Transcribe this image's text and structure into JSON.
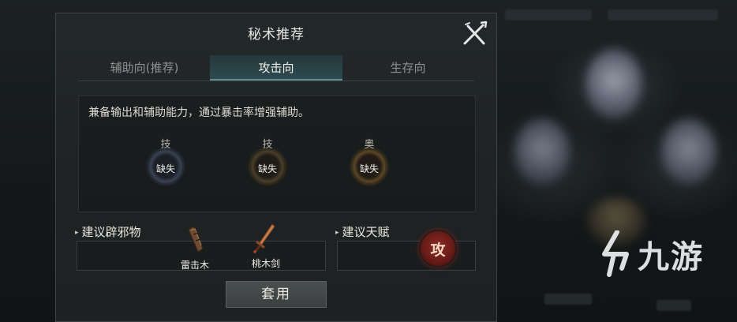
{
  "dialog": {
    "title": "秘术推荐",
    "tabs": [
      {
        "label": "辅助向(推荐)",
        "active": false
      },
      {
        "label": "攻击向",
        "active": true
      },
      {
        "label": "生存向",
        "active": false
      }
    ],
    "description": "兼备输出和辅助能力，通过暴击率增强辅助。",
    "slots": [
      {
        "tag": "技",
        "status": "缺失"
      },
      {
        "tag": "技",
        "status": "缺失"
      },
      {
        "tag": "奥",
        "status": "缺失"
      }
    ],
    "exorcism": {
      "heading": "建议辟邪物",
      "items": [
        {
          "name": "雷击木",
          "icon": "thunderwood-icon"
        },
        {
          "name": "桃木剑",
          "icon": "peachwood-sword-icon"
        }
      ]
    },
    "talent": {
      "heading": "建议天赋",
      "badge": "攻"
    },
    "apply_label": "套用"
  },
  "watermark": {
    "text": "九游"
  },
  "colors": {
    "active_tab": "#2e4a4f",
    "talent_badge": "#8e2a25",
    "panel_bg": "#1f2324"
  }
}
